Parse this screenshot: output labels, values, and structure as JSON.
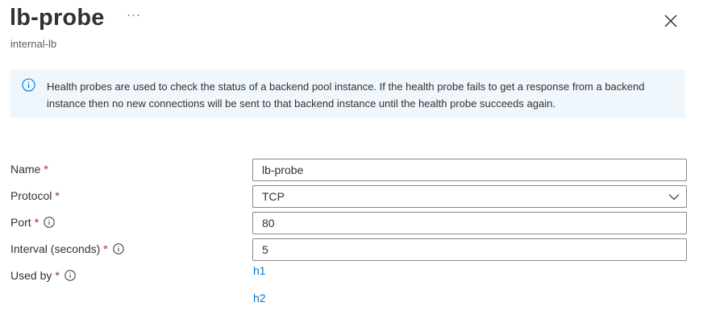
{
  "header": {
    "title": "lb-probe",
    "more_label": "···",
    "subtitle": "internal-lb"
  },
  "info": {
    "text": "Health probes are used to check the status of a backend pool instance. If the health probe fails to get a response from a backend instance then no new connections will be sent to that backend instance until the health probe succeeds again."
  },
  "form": {
    "name": {
      "label": "Name",
      "value": "lb-probe"
    },
    "protocol": {
      "label": "Protocol",
      "value": "TCP"
    },
    "port": {
      "label": "Port",
      "value": "80"
    },
    "interval": {
      "label": "Interval (seconds)",
      "value": "5"
    },
    "used_by": {
      "label": "Used by",
      "items": [
        "h1",
        "h2"
      ]
    },
    "required_mark": "*"
  },
  "colors": {
    "accent": "#0078d4",
    "required": "#a4262c",
    "info_bg": "#eff6fc"
  }
}
